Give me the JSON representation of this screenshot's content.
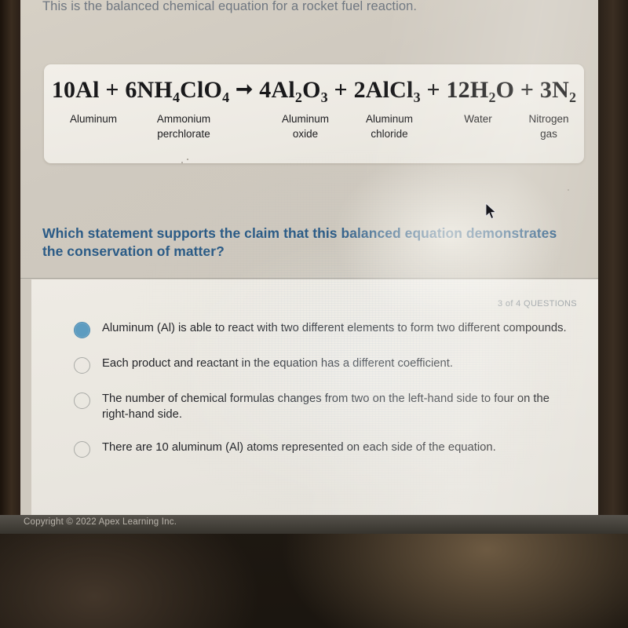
{
  "screen": {
    "intro": "This is the balanced chemical equation for a rocket fuel reaction.",
    "question": "Which statement supports the claim that this balanced equation demonstrates the conservation of matter?",
    "question_counter": "3 of 4 QUESTIONS",
    "copyright": "Copyright © 2022 Apex Learning Inc."
  },
  "equation": {
    "arrow": "➞",
    "reactants": [
      {
        "coefficient": "10",
        "formula": "Al",
        "parts": [
          {
            "t": "Al"
          }
        ],
        "name_line1": "Aluminum",
        "name_line2": ""
      },
      {
        "coefficient": "6",
        "formula": "NH4ClO4",
        "parts": [
          {
            "t": "NH"
          },
          {
            "sub": "4"
          },
          {
            "t": "ClO"
          },
          {
            "sub": "4"
          }
        ],
        "name_line1": "Ammonium",
        "name_line2": "perchlorate"
      }
    ],
    "products": [
      {
        "coefficient": "4",
        "formula": "Al2O3",
        "parts": [
          {
            "t": "Al"
          },
          {
            "sub": "2"
          },
          {
            "t": "O"
          },
          {
            "sub": "3"
          }
        ],
        "name_line1": "Aluminum",
        "name_line2": "oxide"
      },
      {
        "coefficient": "2",
        "formula": "AlCl3",
        "parts": [
          {
            "t": "AlCl"
          },
          {
            "sub": "3"
          }
        ],
        "name_line1": "Aluminum",
        "name_line2": "chloride"
      },
      {
        "coefficient": "12",
        "formula": "H2O",
        "parts": [
          {
            "t": "H"
          },
          {
            "sub": "2"
          },
          {
            "t": "O"
          }
        ],
        "name_line1": "Water",
        "name_line2": ""
      },
      {
        "coefficient": "3",
        "formula": "N2",
        "parts": [
          {
            "t": "N"
          },
          {
            "sub": "2"
          }
        ],
        "name_line1": "Nitrogen",
        "name_line2": "gas"
      }
    ],
    "plus": "+"
  },
  "options": [
    {
      "id": "a",
      "selected": true,
      "text": "Aluminum (Al) is able to react with two different elements to form two different compounds."
    },
    {
      "id": "b",
      "selected": false,
      "text": "Each product and reactant in the equation has a different coefficient."
    },
    {
      "id": "c",
      "selected": false,
      "text": "The number of chemical formulas changes from two on the left-hand side to four on the right-hand side."
    },
    {
      "id": "d",
      "selected": false,
      "text": "There are 10 aluminum (Al) atoms represented on each side of the equation."
    }
  ],
  "colors": {
    "question_blue": "#2b5b86",
    "radio_selected": "#5d9cc0",
    "radio_border": "#a9aaa6",
    "intro_gray": "#6f7781",
    "screen_bg": "#cfc9bf",
    "card_bg": "#f0ede7",
    "footer_bg": "#434039",
    "bezel": "#2b2018"
  }
}
